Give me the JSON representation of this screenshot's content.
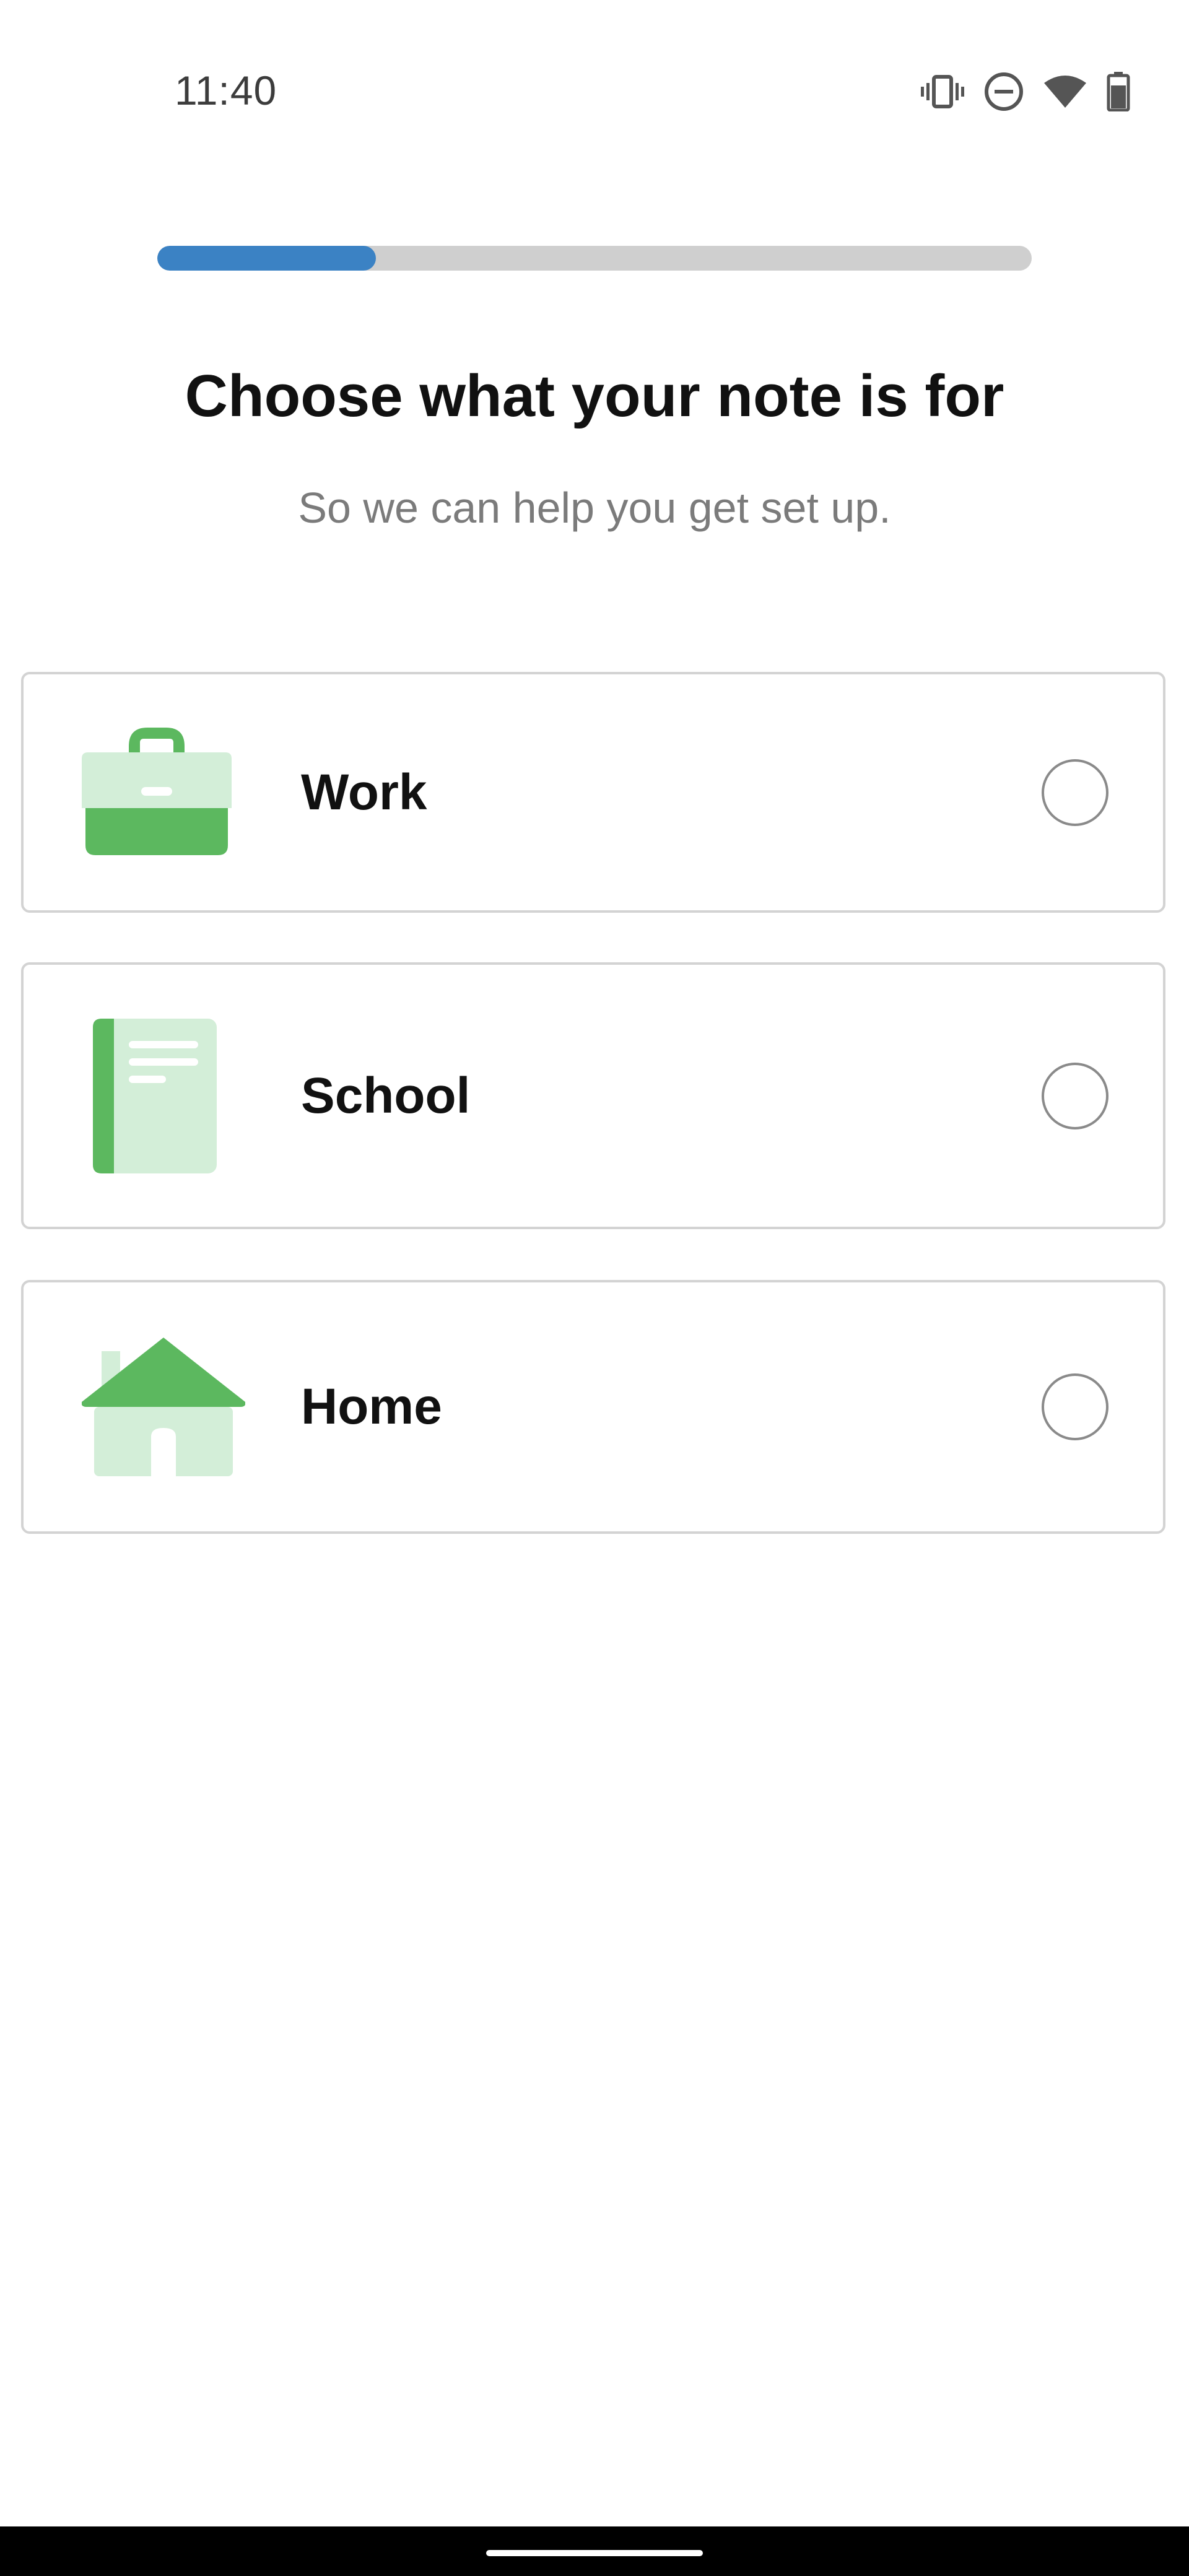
{
  "status_bar": {
    "time": "11:40",
    "icons": [
      "vibrate-icon",
      "do-not-disturb-icon",
      "wifi-icon",
      "battery-icon"
    ]
  },
  "progress": {
    "value": 0.25,
    "color": "#3b82c4",
    "track_color": "#cfcfcf"
  },
  "header": {
    "title": "Choose what your note is for",
    "subtitle": "So we can help you get set up."
  },
  "options": [
    {
      "id": "work",
      "label": "Work",
      "icon": "briefcase-icon",
      "selected": false
    },
    {
      "id": "school",
      "label": "School",
      "icon": "notebook-icon",
      "selected": false
    },
    {
      "id": "home",
      "label": "Home",
      "icon": "house-icon",
      "selected": false
    }
  ],
  "colors": {
    "icon_green": "#5cb85f",
    "icon_light_green": "#d3eed8",
    "text": "#111111",
    "subtitle": "#7b7b7b"
  }
}
